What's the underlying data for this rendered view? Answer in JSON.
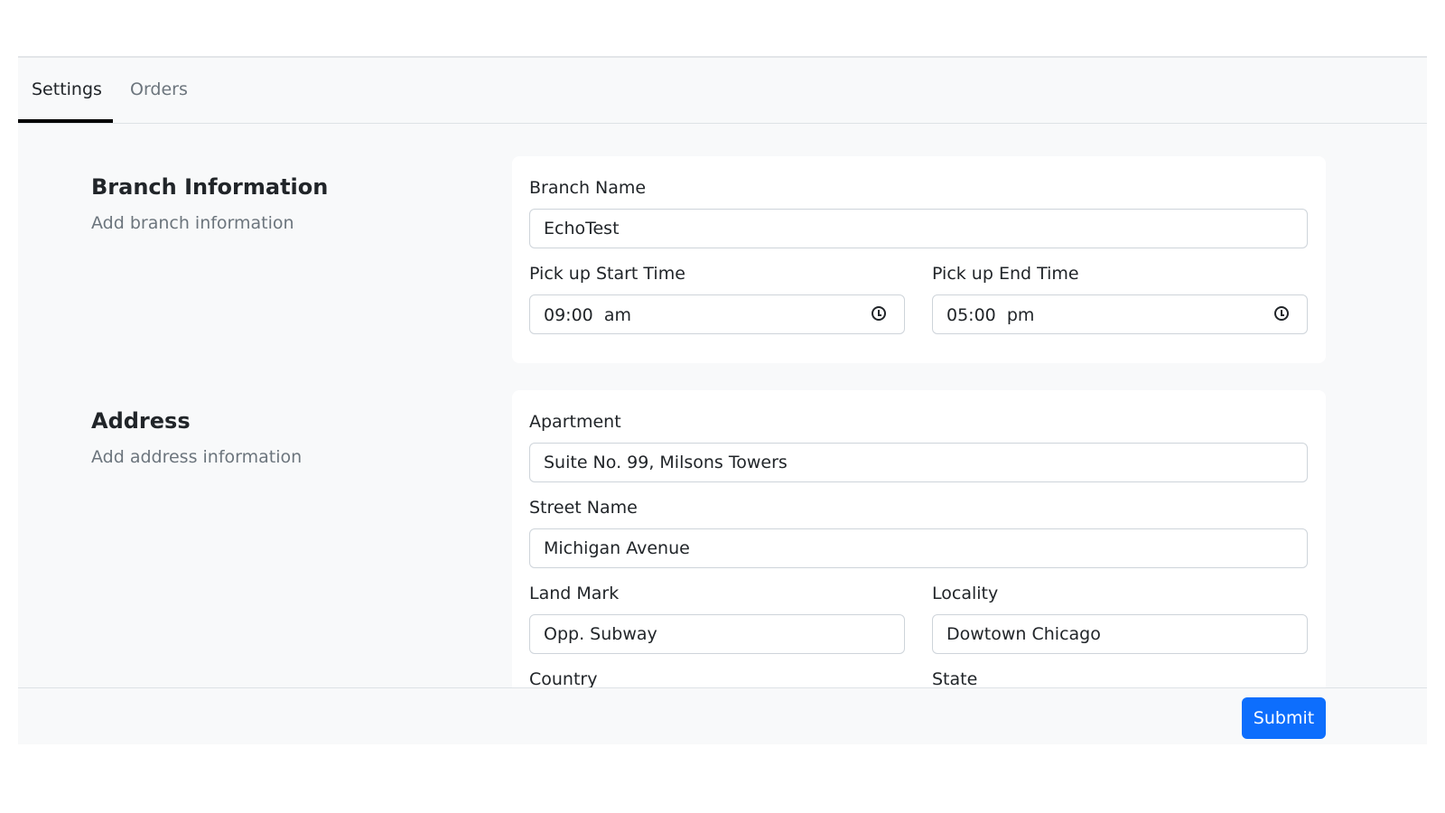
{
  "tabs": [
    {
      "label": "Settings",
      "active": true
    },
    {
      "label": "Orders",
      "active": false
    }
  ],
  "branch": {
    "title": "Branch Information",
    "subtitle": "Add branch information",
    "branch_name_label": "Branch Name",
    "branch_name": "EchoTest",
    "start_label": "Pick up Start Time",
    "start_time": "09:00  am",
    "end_label": "Pick up End Time",
    "end_time": "05:00  pm",
    "time_icon": "clock-icon"
  },
  "address": {
    "title": "Address",
    "subtitle": "Add address information",
    "apartment_label": "Apartment",
    "apartment": "Suite No. 99, Milsons Towers",
    "street_label": "Street Name",
    "street": "Michigan Avenue",
    "landmark_label": "Land Mark",
    "landmark": "Opp. Subway",
    "locality_label": "Locality",
    "locality": "Dowtown Chicago",
    "country_label": "Country",
    "state_label": "State"
  },
  "footer": {
    "submit_label": "Submit"
  },
  "colors": {
    "primary": "#0d6efd",
    "background": "#f8f9fa"
  }
}
